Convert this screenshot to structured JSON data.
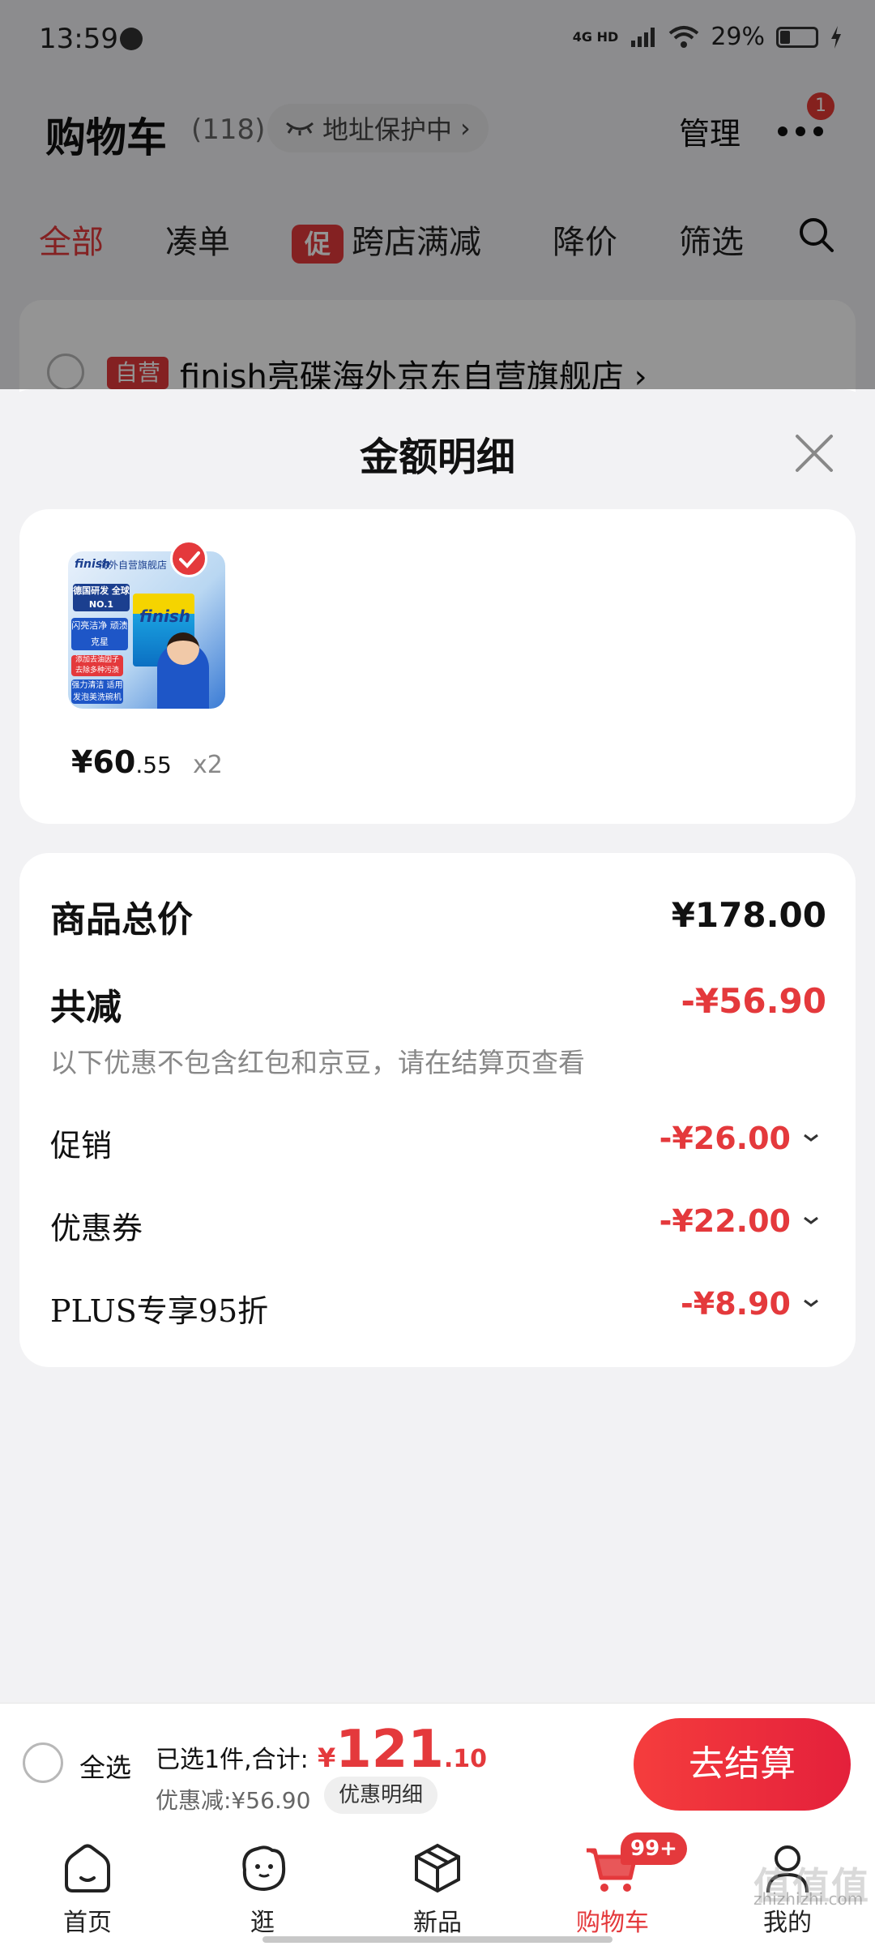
{
  "status_bar": {
    "time": "13:59",
    "network": "4G HD",
    "battery": "29%",
    "battery_level": 0.29
  },
  "cart_header": {
    "title": "购物车",
    "count": "(118)",
    "address_protect": "地址保护中",
    "manage": "管理",
    "more_badge": "1"
  },
  "tabs": [
    {
      "label": "全部",
      "active": true
    },
    {
      "label": "凑单"
    },
    {
      "label": "跨店满减",
      "tag": "促"
    },
    {
      "label": "降价"
    },
    {
      "label": "筛选"
    }
  ],
  "store": {
    "self_tag": "自营",
    "name": "finish亮碟海外京东自营旗舰店 ›"
  },
  "sheet": {
    "title": "金额明细",
    "product": {
      "image_text": {
        "brand": "finish",
        "store_label": "海外自营旗舰店",
        "no1": "德国研发 全球NO.1",
        "blue": "闪亮洁净 顽渍克星",
        "red": "添加去油因子 去除多种污渍",
        "blue2": "强力清洁 适用发泡美洗碗机"
      },
      "price_int": "¥60",
      "price_dec": ".55",
      "qty": "x2"
    },
    "total_label": "商品总价",
    "total_amount": "¥178.00",
    "reduce_label": "共减",
    "reduce_amount": "-¥56.90",
    "note": "以下优惠不包含红包和京豆，请在结算页查看",
    "items": [
      {
        "label": "促销",
        "amount": "-¥26.00"
      },
      {
        "label": "优惠券",
        "amount": "-¥22.00"
      },
      {
        "label": "PLUS专享95折",
        "amount": "-¥8.90"
      }
    ]
  },
  "checkout": {
    "select_all": "全选",
    "selected_info": "已选1件,合计:",
    "price_sym": "¥",
    "price_int": "121",
    "price_dec": ".10",
    "discount": "优惠减:¥56.90",
    "detail_button": "优惠明细",
    "pay_button": "去结算"
  },
  "nav": [
    {
      "label": "首页",
      "icon": "home-icon"
    },
    {
      "label": "逛",
      "icon": "browse-icon"
    },
    {
      "label": "新品",
      "icon": "new-products-icon"
    },
    {
      "label": "购物车",
      "icon": "cart-icon",
      "active": true,
      "badge": "99+"
    },
    {
      "label": "我的",
      "icon": "profile-icon"
    }
  ],
  "watermark": {
    "big": "值值值",
    "small": "zhizhizhi.com"
  },
  "colors": {
    "accent": "#e4393c",
    "background": "#f2f2f4"
  }
}
